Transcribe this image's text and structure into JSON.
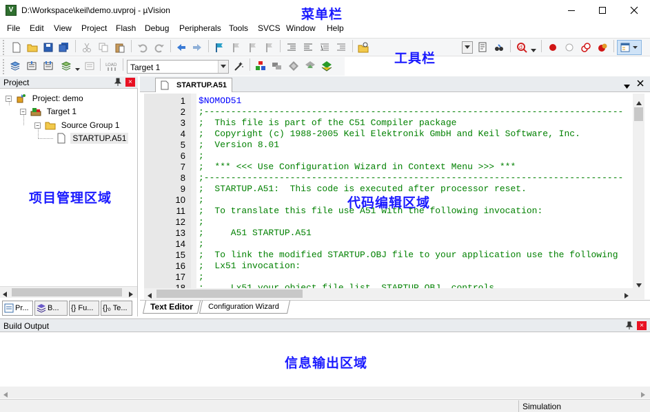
{
  "window": {
    "title": "D:\\Workspace\\keil\\demo.uvproj - µVision",
    "minimize_glyph": "—",
    "maximize_glyph": "☐",
    "close_glyph": "✕"
  },
  "menu": [
    "File",
    "Edit",
    "View",
    "Project",
    "Flash",
    "Debug",
    "Peripherals",
    "Tools",
    "SVCS",
    "Window",
    "Help"
  ],
  "toolbar": {
    "target_select": "Target 1"
  },
  "annotations": {
    "menubar": "菜单栏",
    "toolbar": "工具栏",
    "project_area": "项目管理区域",
    "code_area": "代码编辑区域",
    "output_area": "信息输出区域"
  },
  "project_panel": {
    "title": "Project",
    "pin": "ㄗ",
    "close": "×",
    "tree": {
      "project": "Project: demo",
      "target": "Target 1",
      "group": "Source Group 1",
      "file": "STARTUP.A51"
    },
    "tabs": [
      "Pr...",
      "B...",
      "{} Fu...",
      "{}₀ Te..."
    ]
  },
  "editor": {
    "tab": "STARTUP.A51",
    "lines": [
      {
        "n": "1",
        "t": "$NOMOD51",
        "c": "#0000ff"
      },
      {
        "n": "2",
        "t": ";------------------------------------------------------------------------------",
        "c": "#008000"
      },
      {
        "n": "3",
        "t": ";  This file is part of the C51 Compiler package",
        "c": "#008000"
      },
      {
        "n": "4",
        "t": ";  Copyright (c) 1988-2005 Keil Elektronik GmbH and Keil Software, Inc.",
        "c": "#008000"
      },
      {
        "n": "5",
        "t": ";  Version 8.01",
        "c": "#008000"
      },
      {
        "n": "6",
        "t": ";",
        "c": "#008000"
      },
      {
        "n": "7",
        "t": ";  *** <<< Use Configuration Wizard in Context Menu >>> ***",
        "c": "#008000"
      },
      {
        "n": "8",
        "t": ";------------------------------------------------------------------------------",
        "c": "#008000"
      },
      {
        "n": "9",
        "t": ";  STARTUP.A51:  This code is executed after processor reset.",
        "c": "#008000"
      },
      {
        "n": "10",
        "t": ";",
        "c": "#008000"
      },
      {
        "n": "11",
        "t": ";  To translate this file use A51 with the following invocation:",
        "c": "#008000"
      },
      {
        "n": "12",
        "t": ";",
        "c": "#008000"
      },
      {
        "n": "13",
        "t": ";     A51 STARTUP.A51",
        "c": "#008000"
      },
      {
        "n": "14",
        "t": ";",
        "c": "#008000"
      },
      {
        "n": "15",
        "t": ";  To link the modified STARTUP.OBJ file to your application use the following",
        "c": "#008000"
      },
      {
        "n": "16",
        "t": ";  Lx51 invocation:",
        "c": "#008000"
      },
      {
        "n": "17",
        "t": ";",
        "c": "#008000"
      },
      {
        "n": "18",
        "t": ";     Lx51 your object file list, STARTUP.OBJ  controls",
        "c": "#008000"
      }
    ],
    "bottom_tabs": [
      "Text Editor",
      "Configuration Wizard"
    ]
  },
  "build_output": {
    "title": "Build Output",
    "pin": "ㄗ",
    "close": "×"
  },
  "status": {
    "mode": "Simulation"
  },
  "colors": {
    "accent": "#1a1aff",
    "close_red": "#e81123"
  }
}
